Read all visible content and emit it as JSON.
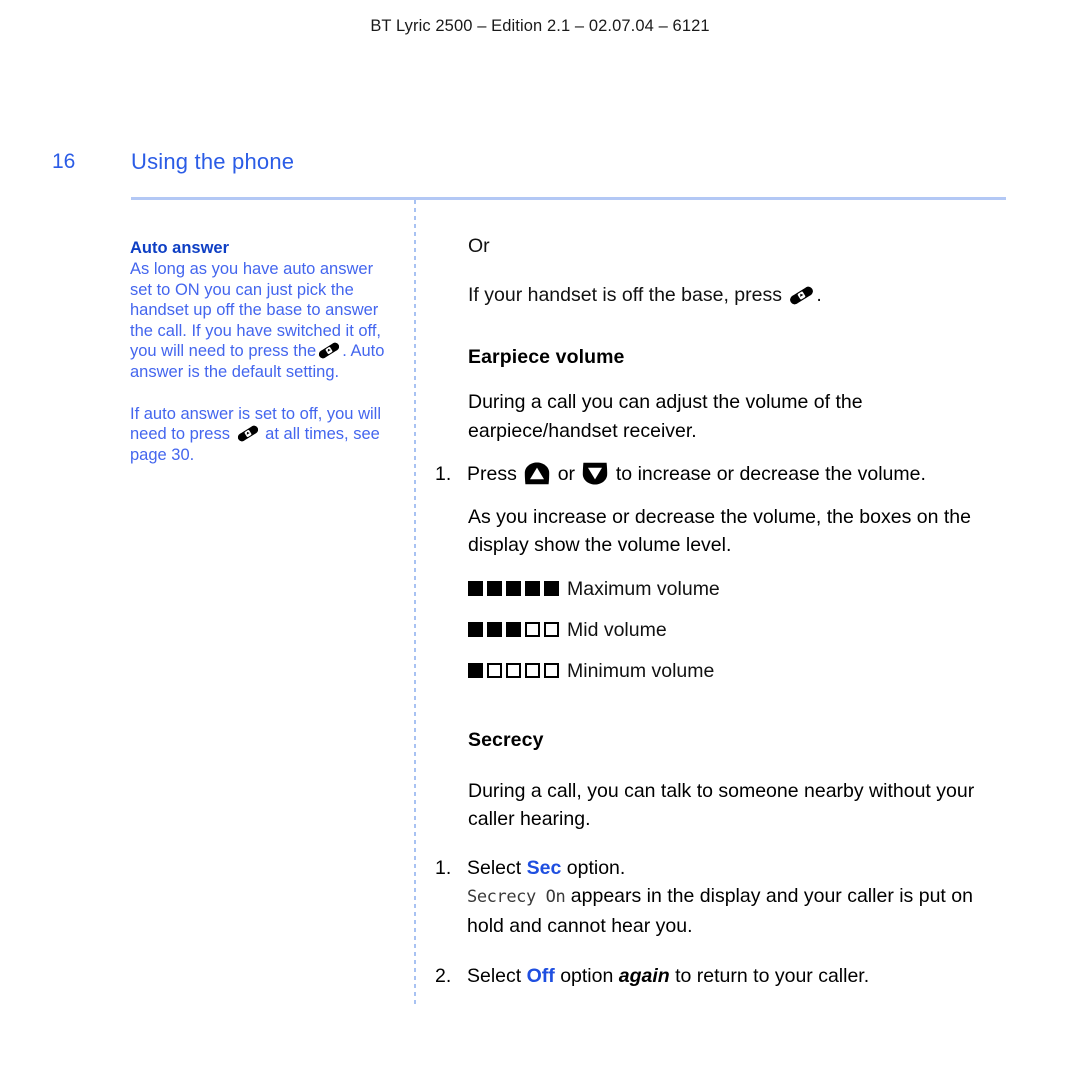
{
  "running_header": "BT Lyric 2500 – Edition 2.1 – 02.07.04 – 6121",
  "page": {
    "folio": "16",
    "title": "Using the phone"
  },
  "colors": {
    "title_blue": "#2b5ce6",
    "rule_blue": "#b3c8f5",
    "sidebar_heading_blue": "#0e3fc4",
    "sidebar_body_blue": "#4466ee",
    "keyword_blue": "#1f4fe0",
    "ink": "#111111"
  },
  "icons": {
    "handset": "phone-handset-icon",
    "volume_up": "volume-up-key-icon",
    "volume_down": "volume-down-key-icon"
  },
  "sidebar": {
    "heading": "Auto answer",
    "para1_a": "As long as you have auto answer set to ON you can just pick the handset up off the base to answer the call. If you have switched it off, you will need to press the",
    "para1_b": ". Auto answer is the default setting.",
    "para2_a": "If auto answer is set to off, you will need to press",
    "para2_b": "at all times, see page 30."
  },
  "main": {
    "or_label": "Or",
    "press_line_a": "If your handset is off the base, press",
    "press_line_b": ".",
    "earpiece": {
      "heading": "Earpiece volume",
      "body": "During a call you can adjust the volume of the earpiece/handset receiver.",
      "step1": {
        "number": "1.",
        "text_a": "Press",
        "text_b": "or",
        "text_c": "to increase or decrease the volume.",
        "sub": "As you increase or decrease the volume, the boxes on the display show the volume level."
      },
      "volume_rows": [
        {
          "filled": 5,
          "total": 5,
          "label": "Maximum volume"
        },
        {
          "filled": 3,
          "total": 5,
          "label": "Mid volume"
        },
        {
          "filled": 1,
          "total": 5,
          "label": "Minimum volume"
        }
      ]
    },
    "secrecy": {
      "heading": "Secrecy",
      "body": "During a call, you can talk to someone nearby without your caller hearing.",
      "step1": {
        "number": "1.",
        "text_a": "Select",
        "keyword": "Sec",
        "text_b": "option.",
        "display_text": "Secrecy On",
        "sub_b": "appears in the display and your caller is put on hold and cannot hear you."
      },
      "step2": {
        "number": "2.",
        "text_a": "Select",
        "keyword": "Off",
        "text_b": "option",
        "emphasis": "again",
        "text_c": "to return to your caller."
      }
    }
  }
}
